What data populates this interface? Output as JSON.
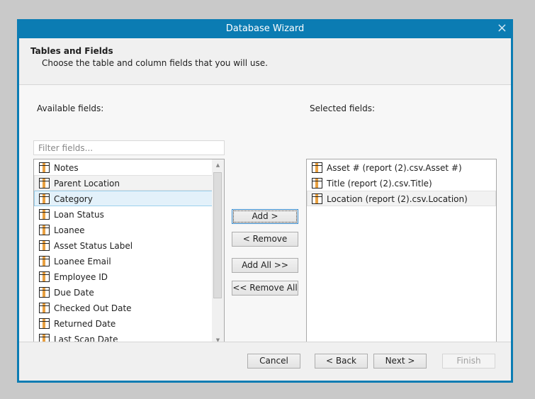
{
  "window": {
    "title": "Database Wizard",
    "close_icon": "×"
  },
  "header": {
    "title": "Tables and Fields",
    "subtitle": "Choose the table and column fields that you will use."
  },
  "available": {
    "label": "Available fields:",
    "filter_placeholder": "Filter fields...",
    "items": [
      "Notes",
      "Parent Location",
      "Category",
      "Loan Status",
      "Loanee",
      "Asset Status Label",
      "Loanee Email",
      "Employee ID",
      "Due Date",
      "Checked Out Date",
      "Returned Date",
      "Last Scan Date"
    ]
  },
  "selected": {
    "label": "Selected fields:",
    "items": [
      "Asset # (report (2).csv.Asset #)",
      "Title (report (2).csv.Title)",
      "Location (report (2).csv.Location)"
    ]
  },
  "actions": {
    "add": "Add >",
    "remove": "< Remove",
    "add_all": "Add All >>",
    "remove_all": "<< Remove All"
  },
  "footer": {
    "cancel": "Cancel",
    "back": "< Back",
    "next": "Next >",
    "finish": "Finish"
  }
}
